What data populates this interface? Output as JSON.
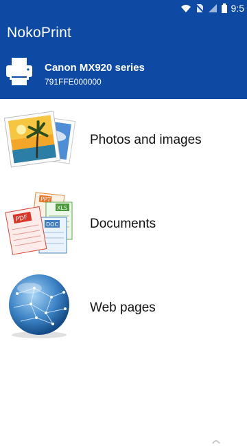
{
  "status_bar": {
    "time": "9:5",
    "icons": [
      "wifi-icon",
      "no-sim-icon",
      "signal-icon",
      "battery-icon"
    ]
  },
  "app_bar": {
    "title": "NokoPrint",
    "background": "#0e4aa3"
  },
  "printer": {
    "name": "Canon MX920 series",
    "id": "791FFE000000",
    "icon": "printer-icon"
  },
  "menu": {
    "items": [
      {
        "label": "Photos and images",
        "icon": "photos-icon"
      },
      {
        "label": "Documents",
        "icon": "documents-icon"
      },
      {
        "label": "Web pages",
        "icon": "globe-icon"
      }
    ]
  },
  "document_tags": {
    "ppt": "PPT",
    "xls": "XLS",
    "pdf": "PDF",
    "doc": "DOC"
  }
}
